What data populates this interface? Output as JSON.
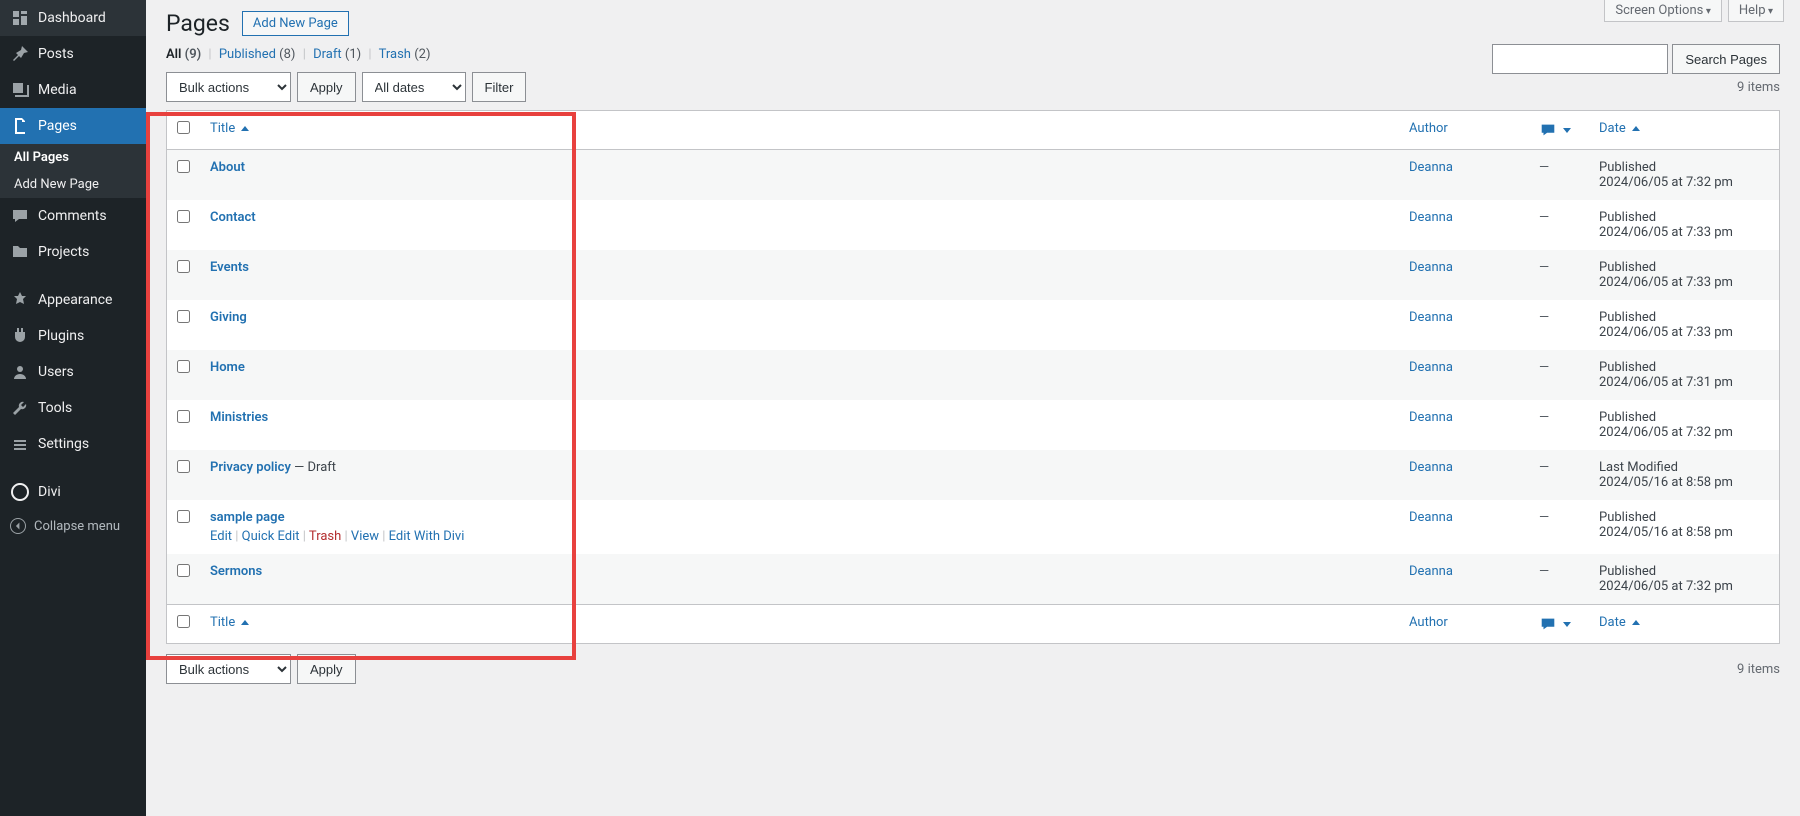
{
  "topTabs": {
    "screenOptions": "Screen Options",
    "help": "Help"
  },
  "heading": {
    "title": "Pages",
    "addNew": "Add New Page"
  },
  "filters": {
    "all": {
      "label": "All",
      "count": "(9)"
    },
    "published": {
      "label": "Published",
      "count": "(8)"
    },
    "draft": {
      "label": "Draft",
      "count": "(1)"
    },
    "trash": {
      "label": "Trash",
      "count": "(2)"
    }
  },
  "bulk": {
    "bulkActions": "Bulk actions",
    "apply": "Apply",
    "allDates": "All dates",
    "filter": "Filter"
  },
  "itemsCount": "9 items",
  "search": {
    "button": "Search Pages",
    "value": ""
  },
  "columns": {
    "title": "Title",
    "author": "Author",
    "date": "Date"
  },
  "rows": [
    {
      "title": "About",
      "author": "Deanna",
      "comments": "—",
      "status": "Published",
      "date": "2024/06/05 at 7:32 pm"
    },
    {
      "title": "Contact",
      "author": "Deanna",
      "comments": "—",
      "status": "Published",
      "date": "2024/06/05 at 7:33 pm"
    },
    {
      "title": "Events",
      "author": "Deanna",
      "comments": "—",
      "status": "Published",
      "date": "2024/06/05 at 7:33 pm"
    },
    {
      "title": "Giving",
      "author": "Deanna",
      "comments": "—",
      "status": "Published",
      "date": "2024/06/05 at 7:33 pm"
    },
    {
      "title": "Home",
      "author": "Deanna",
      "comments": "—",
      "status": "Published",
      "date": "2024/06/05 at 7:31 pm"
    },
    {
      "title": "Ministries",
      "author": "Deanna",
      "comments": "—",
      "status": "Published",
      "date": "2024/06/05 at 7:32 pm"
    },
    {
      "title": "Privacy policy",
      "draft": " — Draft",
      "author": "Deanna",
      "comments": "—",
      "status": "Last Modified",
      "date": "2024/05/16 at 8:58 pm"
    },
    {
      "title": "sample page",
      "author": "Deanna",
      "comments": "—",
      "status": "Published",
      "date": "2024/05/16 at 8:58 pm",
      "actions": {
        "edit": "Edit",
        "quickEdit": "Quick Edit",
        "trash": "Trash",
        "view": "View",
        "divi": "Edit With Divi"
      }
    },
    {
      "title": "Sermons",
      "author": "Deanna",
      "comments": "—",
      "status": "Published",
      "date": "2024/06/05 at 7:32 pm"
    }
  ],
  "sidebar": {
    "dashboard": "Dashboard",
    "posts": "Posts",
    "media": "Media",
    "pages": "Pages",
    "allPages": "All Pages",
    "addNewPage": "Add New Page",
    "comments": "Comments",
    "projects": "Projects",
    "appearance": "Appearance",
    "plugins": "Plugins",
    "users": "Users",
    "tools": "Tools",
    "settings": "Settings",
    "divi": "Divi",
    "collapse": "Collapse menu"
  }
}
